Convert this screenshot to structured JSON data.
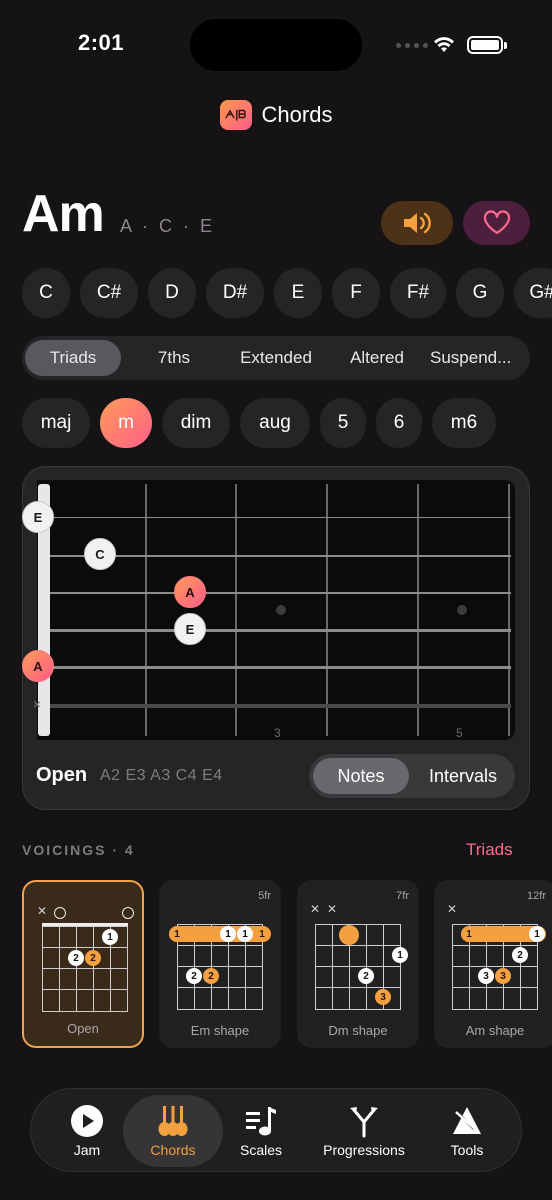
{
  "status": {
    "time": "2:01"
  },
  "header": {
    "title": "Chords",
    "logo_text": "ᗅ|ᗷ"
  },
  "chord": {
    "name": "Am",
    "notes": "A · C · E"
  },
  "roots": [
    "C",
    "C#",
    "D",
    "D#",
    "E",
    "F",
    "F#",
    "G",
    "G#"
  ],
  "categories": {
    "selected": "Triads",
    "items": [
      "Triads",
      "7ths",
      "Extended",
      "Altered",
      "Suspend..."
    ]
  },
  "qualities": {
    "selected": "m",
    "items": [
      "maj",
      "m",
      "dim",
      "aug",
      "5",
      "6",
      "m6"
    ]
  },
  "fretboard": {
    "fret_markers": [
      "3",
      "5"
    ],
    "dots": [
      "E",
      "C",
      "A",
      "E",
      "A"
    ],
    "mute_mark": "×",
    "voicing_label": "Open",
    "voicing_notes": "A2 E3 A3 C4 E4",
    "modes": [
      "Notes",
      "Intervals"
    ],
    "selected_mode": "Notes"
  },
  "voicings": {
    "title": "VOICINGS · 4",
    "link": "Triads",
    "items": [
      {
        "label": "Open",
        "fret": ""
      },
      {
        "label": "Em shape",
        "fret": "5fr"
      },
      {
        "label": "Dm shape",
        "fret": "7fr"
      },
      {
        "label": "Am shape",
        "fret": "12fr"
      }
    ]
  },
  "tabs": [
    {
      "label": "Jam",
      "icon": "play-icon"
    },
    {
      "label": "Chords",
      "icon": "guitars-icon"
    },
    {
      "label": "Scales",
      "icon": "music-note-list-icon"
    },
    {
      "label": "Progressions",
      "icon": "branch-icon"
    },
    {
      "label": "Tools",
      "icon": "tuner-icon"
    }
  ],
  "selected_tab": "Chords",
  "colors": {
    "accent": "#f2a040",
    "pink": "#ff6a8e",
    "background": "#151315"
  }
}
